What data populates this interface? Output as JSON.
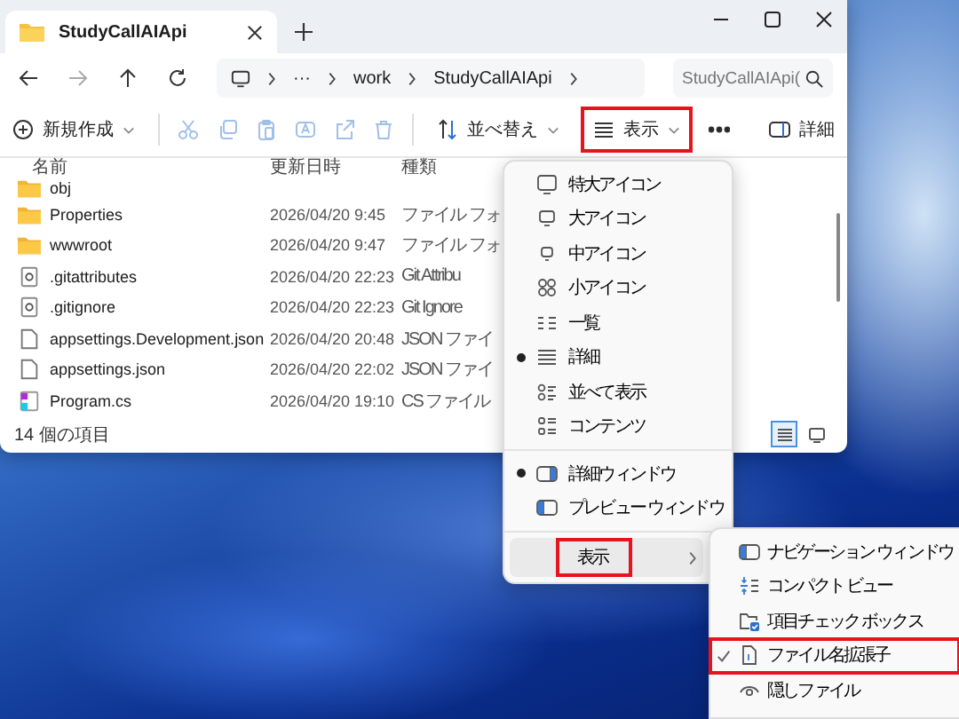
{
  "window": {
    "tab_title": "StudyCallAIApi"
  },
  "address": {
    "path": [
      "···",
      "work",
      "StudyCallAIApi"
    ]
  },
  "search": {
    "placeholder": "StudyCallAIApi("
  },
  "toolbar": {
    "new_label": "新規作成",
    "sort_label": "並べ替え",
    "view": {
      "label": "表示",
      "highlighted": true
    },
    "details_label": "詳細"
  },
  "columns": [
    "名前",
    "更新日時",
    "種類"
  ],
  "files": [
    {
      "kind": "folder",
      "name": "obj"
    },
    {
      "kind": "folder",
      "name": "Properties",
      "date": "2026/04/20 9:45",
      "type": "ファイル フォ"
    },
    {
      "kind": "folder",
      "name": "wwwroot",
      "date": "2026/04/20 9:47",
      "type": "ファイル フォ"
    },
    {
      "kind": "config",
      "name": ".gitattributes",
      "date": "2026/04/20 22:23",
      "type": "Git Attribu"
    },
    {
      "kind": "config",
      "name": ".gitignore",
      "date": "2026/04/20 22:23",
      "type": "Git Ignore"
    },
    {
      "kind": "document",
      "name": "appsettings.Development.json",
      "date": "2026/04/20 20:48",
      "type": "JSON ファイ"
    },
    {
      "kind": "document",
      "name": "appsettings.json",
      "date": "2026/04/20 22:02",
      "type": "JSON ファイ"
    },
    {
      "kind": "csharp",
      "name": "Program.cs",
      "date": "2026/04/20 19:10",
      "type": "CS ファイル"
    }
  ],
  "status": "14 個の項目",
  "view_buttons": [
    {
      "selected": true
    },
    {
      "selected": false
    }
  ],
  "view_menu": [
    {
      "kind": "radio",
      "label": "特大アイコン",
      "selected": false
    },
    {
      "kind": "radio",
      "label": "大アイコン",
      "selected": false
    },
    {
      "kind": "radio",
      "label": "中アイコン",
      "selected": false
    },
    {
      "kind": "radio",
      "label": "小アイコン",
      "selected": false
    },
    {
      "kind": "radio",
      "label": "一覧",
      "selected": false
    },
    {
      "kind": "radio",
      "label": "詳細",
      "selected": true
    },
    {
      "kind": "radio",
      "label": "並べて表示",
      "selected": false
    },
    {
      "kind": "radio",
      "label": "コンテンツ",
      "selected": false
    },
    {
      "kind": "separator"
    },
    {
      "kind": "radio",
      "label": "詳細ウィンドウ",
      "selected": true
    },
    {
      "kind": "radio",
      "label": "プレビュー ウィンドウ",
      "selected": false
    },
    {
      "kind": "separator"
    },
    {
      "kind": "submenu",
      "label": "表示",
      "expanded": true,
      "highlighted": true
    }
  ],
  "submenu": [
    {
      "label": "ナビゲーション ウィンドウ",
      "checked": false,
      "highlighted": false
    },
    {
      "label": "コンパクト ビュー",
      "checked": false,
      "highlighted": false
    },
    {
      "label": "項目チェック ボックス",
      "checked": false,
      "highlighted": false
    },
    {
      "label": "ファイル名拡張子",
      "checked": true,
      "highlighted": true
    },
    {
      "label": "隠しファイル",
      "checked": false,
      "highlighted": false
    }
  ]
}
